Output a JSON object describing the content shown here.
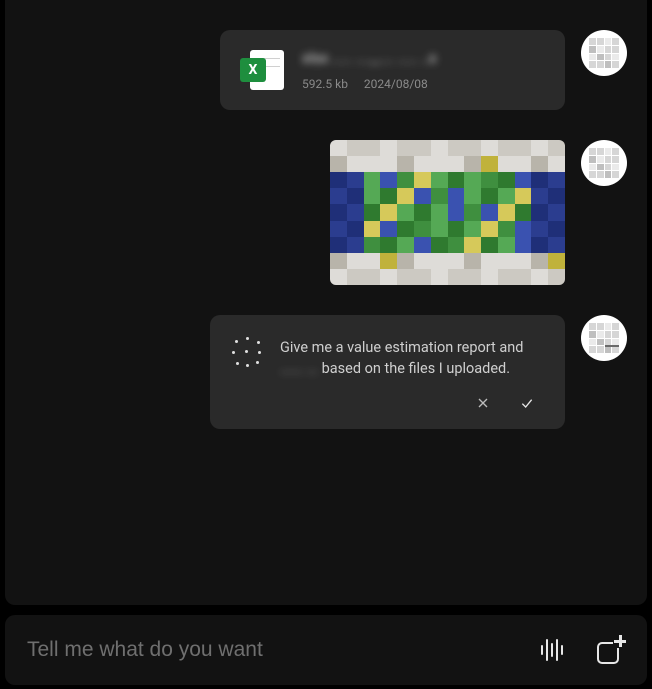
{
  "chat": {
    "file": {
      "name": "xlsx ..... ...._.... ..... ..x",
      "size": "592.5 kb",
      "date": "2024/08/08",
      "badge": "X"
    },
    "prompt": {
      "line1": "Give me a value estimation report and",
      "blur": "...... ...",
      "line2_tail": " based on the files I uploaded."
    }
  },
  "input": {
    "placeholder": "Tell me what do you want"
  },
  "icons": {
    "excel": "excel-icon",
    "sparkle": "sparkle-icon",
    "reject": "close-icon",
    "accept": "check-icon",
    "voice": "voice-wave-icon",
    "newchat": "new-chat-icon"
  }
}
